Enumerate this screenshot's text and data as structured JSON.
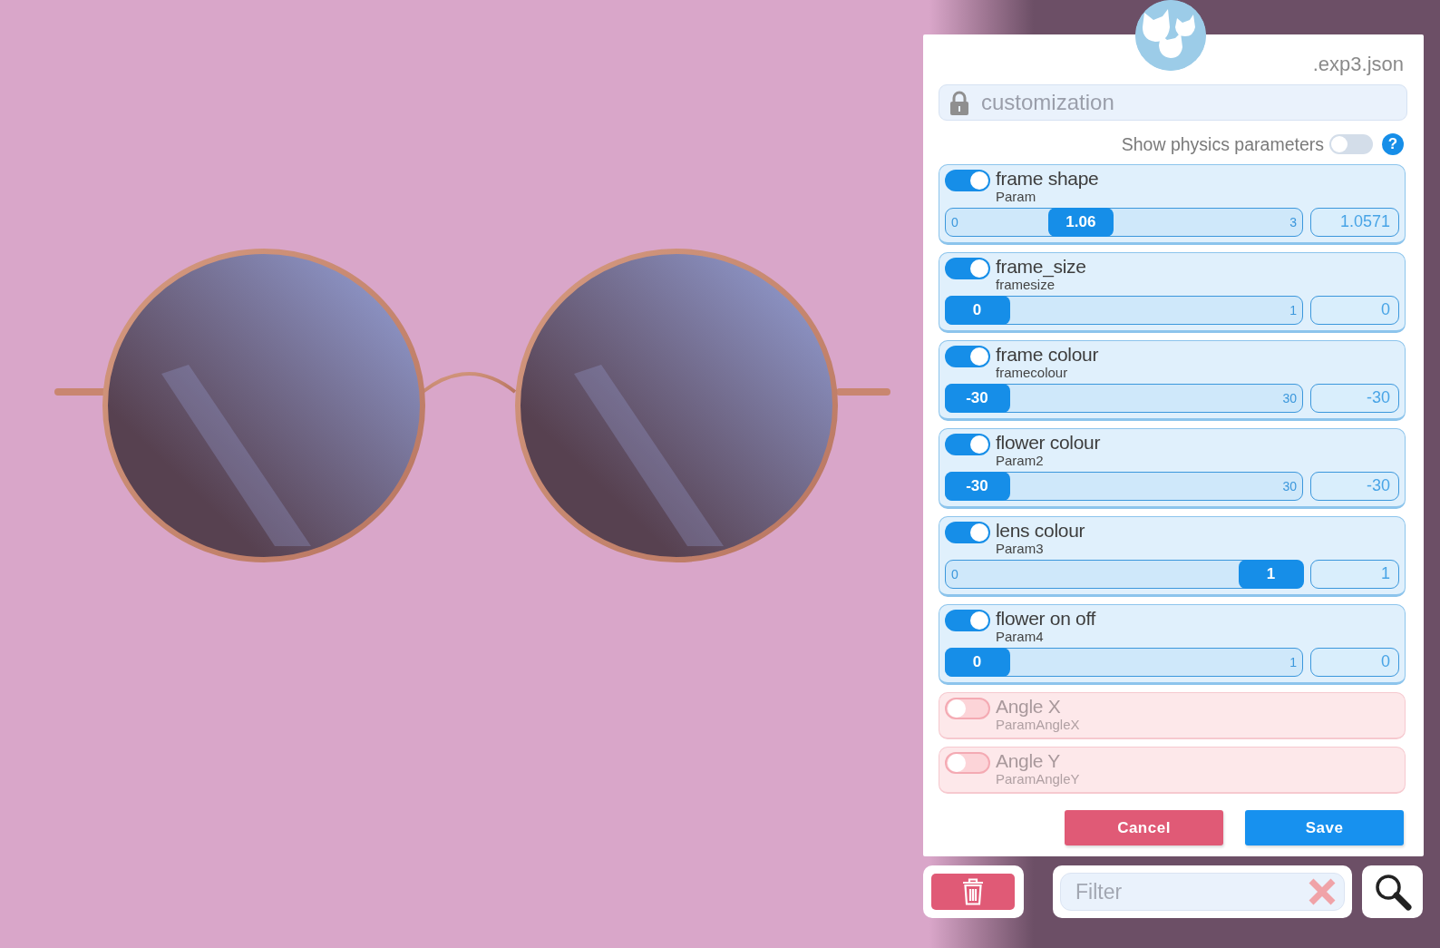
{
  "file_suffix": ".exp3.json",
  "name_field": {
    "value": "customization",
    "locked": true
  },
  "physics_toggle": {
    "label": "Show physics parameters",
    "on": false
  },
  "help": "?",
  "parameters": [
    {
      "name": "frame shape",
      "id": "Param",
      "enabled": true,
      "min": "0",
      "max": "3",
      "level": 0.353,
      "thumb": "1.06",
      "value": "1.0571"
    },
    {
      "name": "frame_size",
      "id": "framesize",
      "enabled": true,
      "max": "1",
      "level": 0,
      "thumb": "0",
      "value": "0"
    },
    {
      "name": "frame colour",
      "id": "framecolour",
      "enabled": true,
      "max": "30",
      "level": 0,
      "thumb": "-30",
      "value": "-30"
    },
    {
      "name": "flower colour",
      "id": "Param2",
      "enabled": true,
      "max": "30",
      "level": 0,
      "thumb": "-30",
      "value": "-30"
    },
    {
      "name": "lens colour",
      "id": "Param3",
      "enabled": true,
      "min": "0",
      "level": 1,
      "thumb": "1",
      "value": "1"
    },
    {
      "name": "flower on off",
      "id": "Param4",
      "enabled": true,
      "max": "1",
      "level": 0,
      "thumb": "0",
      "value": "0"
    },
    {
      "name": "Angle X",
      "id": "ParamAngleX",
      "enabled": false
    },
    {
      "name": "Angle Y",
      "id": "ParamAngleY",
      "enabled": false
    }
  ],
  "buttons": {
    "cancel": "Cancel",
    "save": "Save"
  },
  "filter": {
    "placeholder": "Filter"
  }
}
